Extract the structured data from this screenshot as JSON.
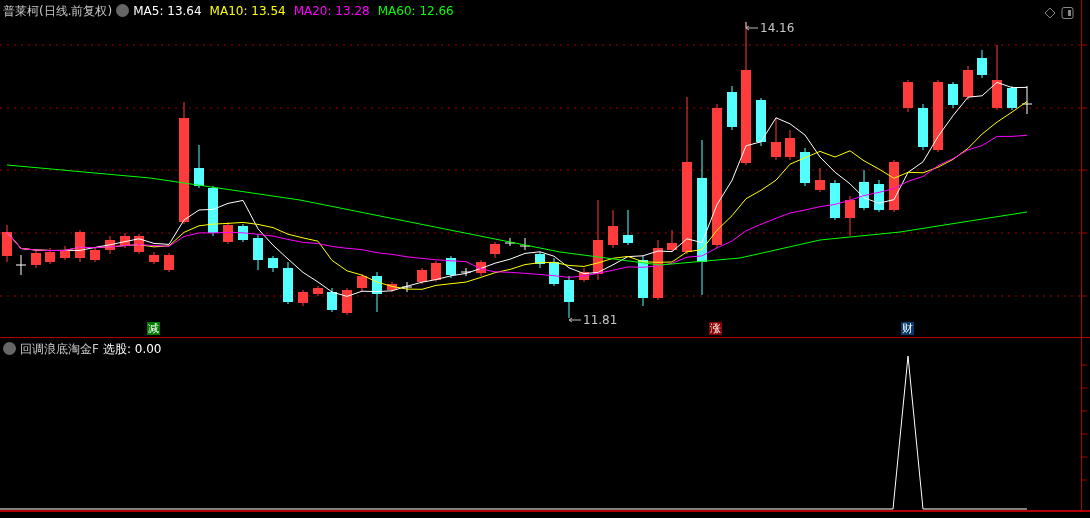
{
  "title": "普莱柯(日线.前复权)",
  "moving_averages": [
    {
      "label": "MA5: 13.64",
      "color": "#ffffff"
    },
    {
      "label": "MA10: 13.54",
      "color": "#ffff00"
    },
    {
      "label": "MA20: 13.28",
      "color": "#ff00ff"
    },
    {
      "label": "MA60: 12.66",
      "color": "#00ff00"
    }
  ],
  "price_markers": [
    {
      "text": "14.16"
    },
    {
      "text": "11.81"
    }
  ],
  "signal_badges": [
    {
      "text": "减",
      "color": "#007a00"
    },
    {
      "text": "涨",
      "color": "#8b0000"
    },
    {
      "text": "财",
      "color": "#0a3b6e"
    }
  ],
  "indicator": {
    "name": "回调浪底淘金F",
    "value_label": "选股: 0.00"
  }
}
